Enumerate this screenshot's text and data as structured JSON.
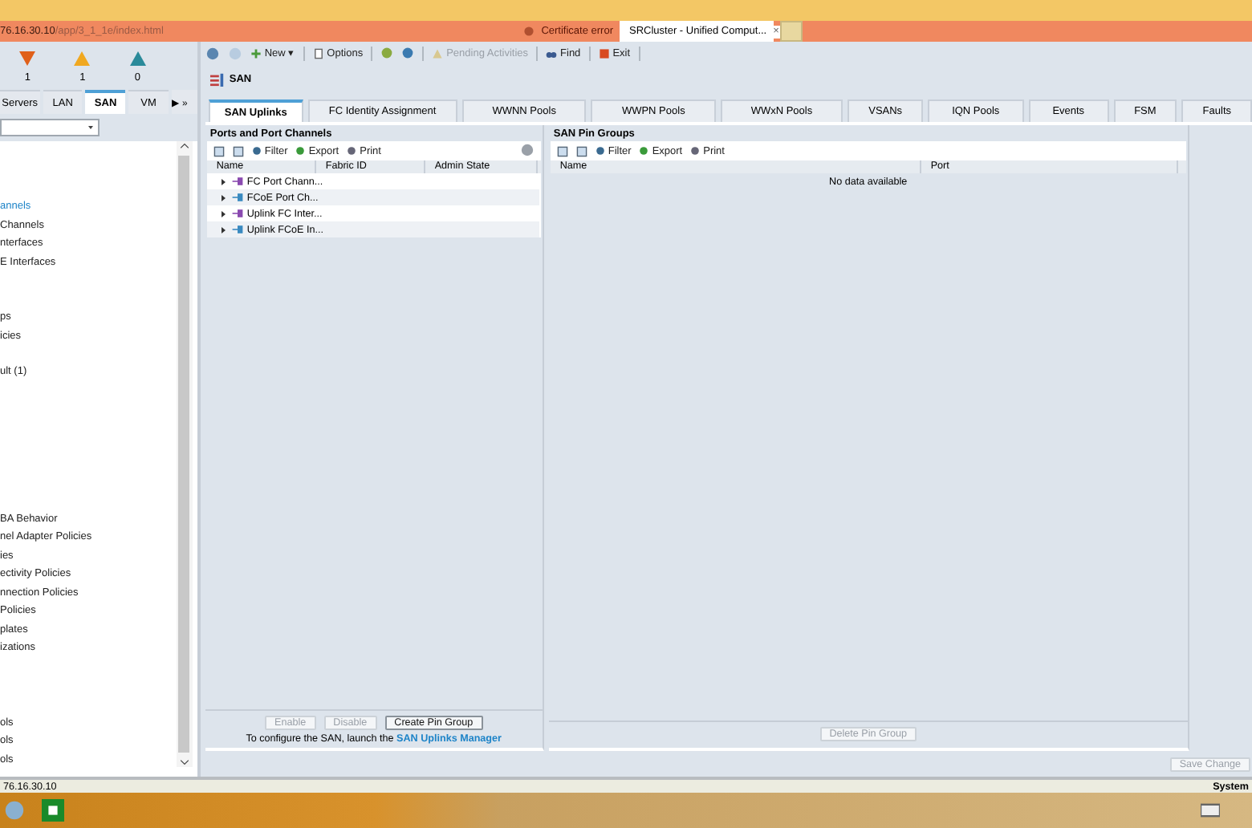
{
  "browser": {
    "url_host": "76.16.30.10",
    "url_path": "/app/3_1_1e/index.html",
    "cert_error": "Certificate error",
    "tab_title": "SRCluster - Unified Comput...",
    "tab_close": "×"
  },
  "fault_summary": [
    {
      "kind": "critical",
      "count": "1"
    },
    {
      "kind": "major",
      "count": "1"
    },
    {
      "kind": "minor",
      "count": "0"
    }
  ],
  "nav_tabs": [
    {
      "label": "Servers",
      "selected": false
    },
    {
      "label": "LAN",
      "selected": false
    },
    {
      "label": "SAN",
      "selected": true
    },
    {
      "label": "VM",
      "selected": false
    }
  ],
  "nav_more": "▶ »",
  "tree_groups": [
    [
      {
        "label": "annels",
        "selected": true
      },
      {
        "label": "Channels",
        "selected": false
      },
      {
        "label": "nterfaces",
        "selected": false
      },
      {
        "label": "E Interfaces",
        "selected": false
      }
    ],
    [
      {
        "label": "ps",
        "selected": false
      },
      {
        "label": "icies",
        "selected": false
      }
    ],
    [
      {
        "label": "ult (1)",
        "selected": false
      }
    ],
    [
      {
        "label": "BA Behavior",
        "selected": false
      },
      {
        "label": "nel Adapter Policies",
        "selected": false
      },
      {
        "label": "ies",
        "selected": false
      },
      {
        "label": "ectivity Policies",
        "selected": false
      },
      {
        "label": "nnection Policies",
        "selected": false
      },
      {
        "label": "Policies",
        "selected": false
      },
      {
        "label": "plates",
        "selected": false
      },
      {
        "label": "izations",
        "selected": false
      }
    ],
    [
      {
        "label": "ols",
        "selected": false
      },
      {
        "label": "ols",
        "selected": false
      },
      {
        "label": "ols",
        "selected": false
      }
    ]
  ],
  "toolbar": [
    {
      "kind": "back"
    },
    {
      "kind": "forward"
    },
    {
      "kind": "new",
      "label": "New ▾",
      "disabled": false
    },
    {
      "kind": "options",
      "label": "Options",
      "disabled": false
    },
    {
      "kind": "help"
    },
    {
      "kind": "info"
    },
    {
      "kind": "pending",
      "label": "Pending Activities",
      "disabled": true
    },
    {
      "kind": "find",
      "label": "Find",
      "disabled": false
    },
    {
      "kind": "exit",
      "label": "Exit",
      "disabled": false
    }
  ],
  "breadcrumb": "SAN",
  "tabs": [
    {
      "label": "SAN Uplinks",
      "selected": true
    },
    {
      "label": "FC Identity Assignment",
      "selected": false
    },
    {
      "label": "WWNN Pools",
      "selected": false
    },
    {
      "label": "WWPN Pools",
      "selected": false
    },
    {
      "label": "WWxN Pools",
      "selected": false
    },
    {
      "label": "VSANs",
      "selected": false
    },
    {
      "label": "IQN Pools",
      "selected": false
    },
    {
      "label": "Events",
      "selected": false
    },
    {
      "label": "FSM",
      "selected": false
    },
    {
      "label": "Faults",
      "selected": false
    }
  ],
  "ports_panel": {
    "title": "Ports and Port Channels",
    "actions": [
      "Filter",
      "Export",
      "Print"
    ],
    "columns": [
      "Name",
      "Fabric ID",
      "Admin State"
    ],
    "rows": [
      {
        "name": "FC Port Chann...",
        "kind": "fc"
      },
      {
        "name": "FCoE Port Ch...",
        "kind": "fcoe"
      },
      {
        "name": "Uplink FC Inter...",
        "kind": "fc"
      },
      {
        "name": "Uplink FCoE In...",
        "kind": "fcoe"
      }
    ],
    "buttons": [
      {
        "label": "Enable",
        "disabled": true
      },
      {
        "label": "Disable",
        "disabled": true
      },
      {
        "label": "Create Pin Group",
        "disabled": false
      }
    ],
    "note": "To configure the SAN, launch the",
    "note_link": "SAN Uplinks Manager"
  },
  "pin_panel": {
    "title": "SAN Pin Groups",
    "actions": [
      "Filter",
      "Export",
      "Print"
    ],
    "columns": [
      "Name",
      "Port"
    ],
    "empty": "No data available",
    "button": {
      "label": "Delete Pin Group",
      "disabled": true
    }
  },
  "save_button": {
    "label": "Save Change",
    "disabled": true
  },
  "status_bar": {
    "host": "76.16.30.10",
    "right": "System"
  }
}
